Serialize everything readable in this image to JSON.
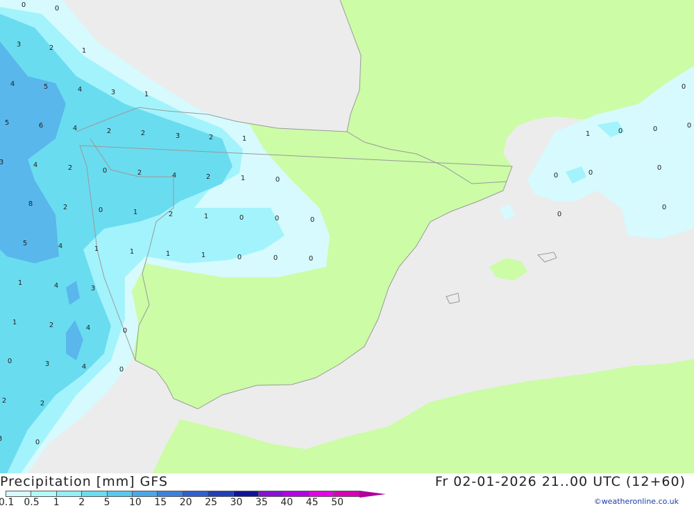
{
  "map": {
    "colors": {
      "sea": "#ececec",
      "land": "#ccfca6",
      "coast": "#999999",
      "precip_0": "#d6fafd",
      "precip_1": "#a3f3fc",
      "precip_2": "#6adcf0",
      "precip_5": "#59b7ec"
    },
    "value_labels": [
      "0",
      "0",
      "3",
      "2",
      "1",
      "4",
      "5",
      "4",
      "3",
      "1",
      "5",
      "6",
      "4",
      "2",
      "2",
      "3",
      "2",
      "1",
      "3",
      "4",
      "2",
      "0",
      "2",
      "4",
      "2",
      "1",
      "0",
      "8",
      "2",
      "0",
      "1",
      "2",
      "1",
      "0",
      "0",
      "0",
      "5",
      "4",
      "1",
      "1",
      "1",
      "1",
      "0",
      "0",
      "0",
      "1",
      "4",
      "3",
      "1",
      "2",
      "4",
      "0",
      "0",
      "3",
      "4",
      "0",
      "2",
      "2",
      "3",
      "0",
      "0",
      "1",
      "0",
      "0",
      "0",
      "0",
      "0",
      "0",
      "0",
      "0"
    ]
  },
  "footer": {
    "title_left": "Precipitation [mm] GFS",
    "title_right": "Fr 02-01-2026 21..00 UTC (12+60)",
    "credit": "©weatheronline.co.uk",
    "legend": {
      "ticks": [
        "0.1",
        "0.5",
        "1",
        "2",
        "5",
        "10",
        "15",
        "20",
        "25",
        "30",
        "35",
        "40",
        "45",
        "50"
      ],
      "colors": [
        "#d6fafd",
        "#b4f8fb",
        "#94eef4",
        "#6adcf0",
        "#59c8ec",
        "#4aa8e6",
        "#3c82de",
        "#3060d0",
        "#2040b8",
        "#10149a",
        "#8a10d8",
        "#b400e6",
        "#e600e6",
        "#d800b4",
        "#b0009c"
      ]
    }
  }
}
